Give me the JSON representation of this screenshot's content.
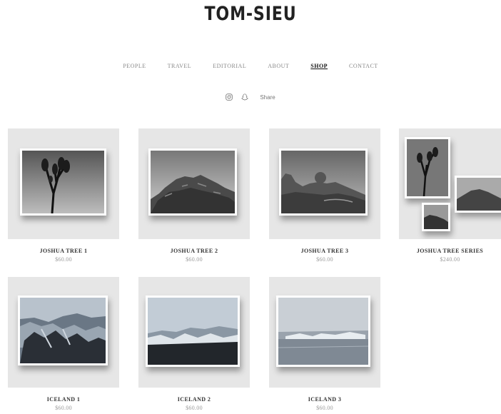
{
  "site": {
    "logo": "TOM-SIEU"
  },
  "nav": {
    "items": [
      {
        "label": "PEOPLE",
        "active": false
      },
      {
        "label": "TRAVEL",
        "active": false
      },
      {
        "label": "EDITORIAL",
        "active": false
      },
      {
        "label": "ABOUT",
        "active": false
      },
      {
        "label": "SHOP",
        "active": true
      },
      {
        "label": "CONTACT",
        "active": false
      }
    ]
  },
  "social": {
    "icons": [
      "instagram-icon",
      "snapchat-icon"
    ],
    "share_label": "Share"
  },
  "products": [
    {
      "title": "JOSHUA TREE 1",
      "price": "$60.00"
    },
    {
      "title": "JOSHUA TREE 2",
      "price": "$60.00"
    },
    {
      "title": "JOSHUA TREE 3",
      "price": "$60.00"
    },
    {
      "title": "JOSHUA TREE SERIES",
      "price": "$240.00"
    },
    {
      "title": "ICELAND 1",
      "price": "$60.00"
    },
    {
      "title": "ICELAND 2",
      "price": "$60.00"
    },
    {
      "title": "ICELAND 3",
      "price": "$60.00"
    }
  ]
}
